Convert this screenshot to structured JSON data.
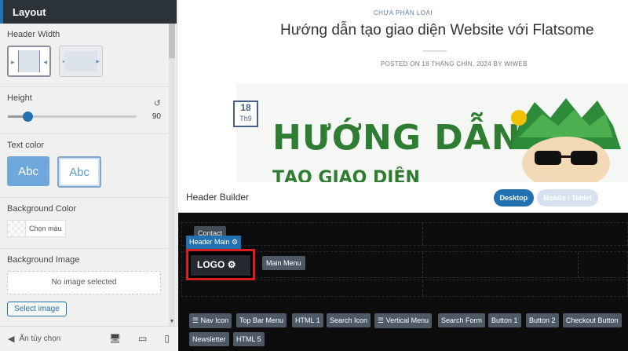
{
  "panel": {
    "title": "Layout",
    "header_width_label": "Header Width",
    "height_label": "Height",
    "height_value": "90",
    "height_fraction": 0.15,
    "text_color_label": "Text color",
    "text_color_options": [
      "Abc",
      "Abc"
    ],
    "bg_color_label": "Background Color",
    "choose_color": "Chọn màu",
    "bg_image_label": "Background Image",
    "no_image": "No image selected",
    "select_image": "Select image",
    "hide_options": "Ẩn tùy chọn"
  },
  "post": {
    "category": "CHƯA PHÂN LOẠI",
    "title": "Hướng dẫn tạo giao diện Website với Flatsome",
    "posted": "POSTED ON 18 THÁNG CHÍN, 2024 BY WIWEB",
    "date_day": "18",
    "date_month": "Th9",
    "banner_line1": "HƯỚNG DẪN",
    "banner_line2": "TẠO GIAO DIỆN"
  },
  "builder": {
    "title": "Header Builder",
    "desktop": "Desktop",
    "mobile": "Mobile / Tablet",
    "contact": "Contact",
    "header_main": "Header Main",
    "logo": "LOGO",
    "main_menu": "Main Menu",
    "elements": [
      "☰ Nav Icon",
      "Top Bar Menu",
      "HTML 1",
      "Search Icon",
      "☰ Vertical Menu",
      "Search Form",
      "Button 1",
      "Button 2",
      "Checkout Button",
      "Newsletter",
      "HTML 5"
    ]
  },
  "colors": {
    "accent": "#2271b1",
    "highlight": "#d92020",
    "brand_green": "#2e7d32"
  }
}
